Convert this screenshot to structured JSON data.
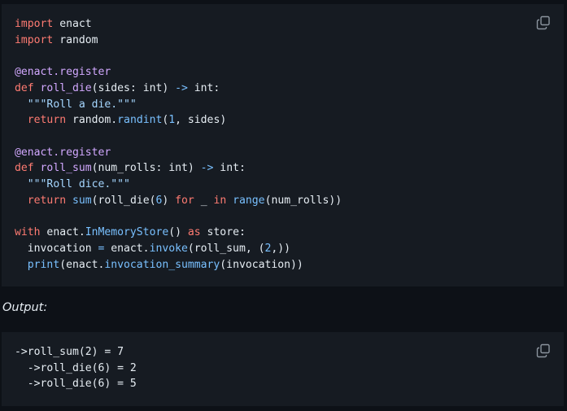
{
  "code_block": {
    "lines": [
      [
        {
          "t": "import",
          "c": "kw"
        },
        {
          "t": " enact",
          "c": "txt"
        }
      ],
      [
        {
          "t": "import",
          "c": "kw"
        },
        {
          "t": " random",
          "c": "txt"
        }
      ],
      [],
      [
        {
          "t": "@enact.register",
          "c": "dec"
        }
      ],
      [
        {
          "t": "def",
          "c": "kw"
        },
        {
          "t": " ",
          "c": "txt"
        },
        {
          "t": "roll_die",
          "c": "fn"
        },
        {
          "t": "(sides: int) ",
          "c": "txt"
        },
        {
          "t": "->",
          "c": "op"
        },
        {
          "t": " int:",
          "c": "txt"
        }
      ],
      [
        {
          "t": "  ",
          "c": "txt"
        },
        {
          "t": "\"\"\"Roll a die.\"\"\"",
          "c": "str"
        }
      ],
      [
        {
          "t": "  ",
          "c": "txt"
        },
        {
          "t": "return",
          "c": "kw"
        },
        {
          "t": " random.",
          "c": "txt"
        },
        {
          "t": "randint",
          "c": "bi"
        },
        {
          "t": "(",
          "c": "txt"
        },
        {
          "t": "1",
          "c": "num"
        },
        {
          "t": ", sides)",
          "c": "txt"
        }
      ],
      [],
      [
        {
          "t": "@enact.register",
          "c": "dec"
        }
      ],
      [
        {
          "t": "def",
          "c": "kw"
        },
        {
          "t": " ",
          "c": "txt"
        },
        {
          "t": "roll_sum",
          "c": "fn"
        },
        {
          "t": "(num_rolls: int) ",
          "c": "txt"
        },
        {
          "t": "->",
          "c": "op"
        },
        {
          "t": " int:",
          "c": "txt"
        }
      ],
      [
        {
          "t": "  ",
          "c": "txt"
        },
        {
          "t": "\"\"\"Roll dice.\"\"\"",
          "c": "str"
        }
      ],
      [
        {
          "t": "  ",
          "c": "txt"
        },
        {
          "t": "return",
          "c": "kw"
        },
        {
          "t": " ",
          "c": "txt"
        },
        {
          "t": "sum",
          "c": "bi"
        },
        {
          "t": "(roll_die(",
          "c": "txt"
        },
        {
          "t": "6",
          "c": "num"
        },
        {
          "t": ") ",
          "c": "txt"
        },
        {
          "t": "for",
          "c": "kw"
        },
        {
          "t": " _ ",
          "c": "txt"
        },
        {
          "t": "in",
          "c": "kw"
        },
        {
          "t": " ",
          "c": "txt"
        },
        {
          "t": "range",
          "c": "bi"
        },
        {
          "t": "(num_rolls))",
          "c": "txt"
        }
      ],
      [],
      [
        {
          "t": "with",
          "c": "kw"
        },
        {
          "t": " enact.",
          "c": "txt"
        },
        {
          "t": "InMemoryStore",
          "c": "bi"
        },
        {
          "t": "() ",
          "c": "txt"
        },
        {
          "t": "as",
          "c": "kw"
        },
        {
          "t": " store:",
          "c": "txt"
        }
      ],
      [
        {
          "t": "  invocation ",
          "c": "txt"
        },
        {
          "t": "=",
          "c": "op"
        },
        {
          "t": " enact.",
          "c": "txt"
        },
        {
          "t": "invoke",
          "c": "bi"
        },
        {
          "t": "(roll_sum, (",
          "c": "txt"
        },
        {
          "t": "2",
          "c": "num"
        },
        {
          "t": ",))",
          "c": "txt"
        }
      ],
      [
        {
          "t": "  ",
          "c": "txt"
        },
        {
          "t": "print",
          "c": "bi"
        },
        {
          "t": "(enact.",
          "c": "txt"
        },
        {
          "t": "invocation_summary",
          "c": "bi"
        },
        {
          "t": "(invocation))",
          "c": "txt"
        }
      ]
    ]
  },
  "output_label": "Output:",
  "output_block": {
    "lines": [
      "->roll_sum(2) = 7",
      "  ->roll_die(6) = 2",
      "  ->roll_die(6) = 5"
    ]
  },
  "icons": {
    "copy": "copy-icon"
  },
  "colors": {
    "page_bg": "#0d1117",
    "block_bg": "#161b22",
    "keyword": "#ff7b72",
    "function": "#d2a8ff",
    "builtin": "#79c0ff",
    "string": "#a5d6ff",
    "text": "#e6edf3"
  }
}
